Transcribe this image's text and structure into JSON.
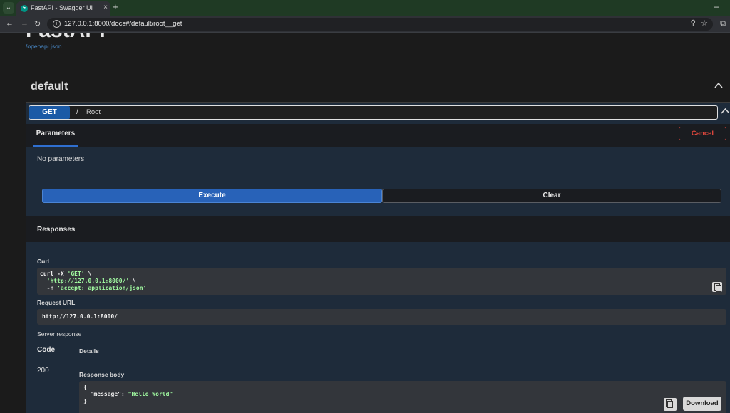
{
  "browser": {
    "tab_title": "FastAPI - Swagger UI",
    "tab_close": "×",
    "new_tab": "+",
    "minimize": "–",
    "url": "127.0.0.1:8000/docs#/default/root__get"
  },
  "header": {
    "title": "FastAPI",
    "openapi_link": "/openapi.json"
  },
  "section": {
    "name": "default"
  },
  "operation": {
    "method": "GET",
    "path": "/",
    "description": "Root",
    "parameters_tab": "Parameters",
    "cancel_label": "Cancel",
    "no_params": "No parameters",
    "execute_label": "Execute",
    "clear_label": "Clear"
  },
  "responses": {
    "title": "Responses",
    "curl_label": "Curl",
    "curl_line1_pre": "curl -X ",
    "curl_line1_str": "'GET'",
    "curl_line1_post": " \\",
    "curl_line2_pre": "  ",
    "curl_line2_str": "'http://127.0.0.1:8000/'",
    "curl_line2_post": " \\",
    "curl_line3_pre": "  -H ",
    "curl_line3_str": "'accept: application/json'",
    "request_url_label": "Request URL",
    "request_url": "http://127.0.0.1:8000/",
    "server_response_label": "Server response",
    "code_header": "Code",
    "details_header": "Details",
    "status_code": "200",
    "response_body_label": "Response body",
    "body_open": "{",
    "body_key": "  \"message\": ",
    "body_value": "\"Hello World\"",
    "body_close": "}",
    "download_label": "Download"
  },
  "colors": {
    "get_method": "#1b5aa6",
    "execute": "#2862b8",
    "cancel": "#e2483d",
    "string_literal": "#a2fca2"
  }
}
